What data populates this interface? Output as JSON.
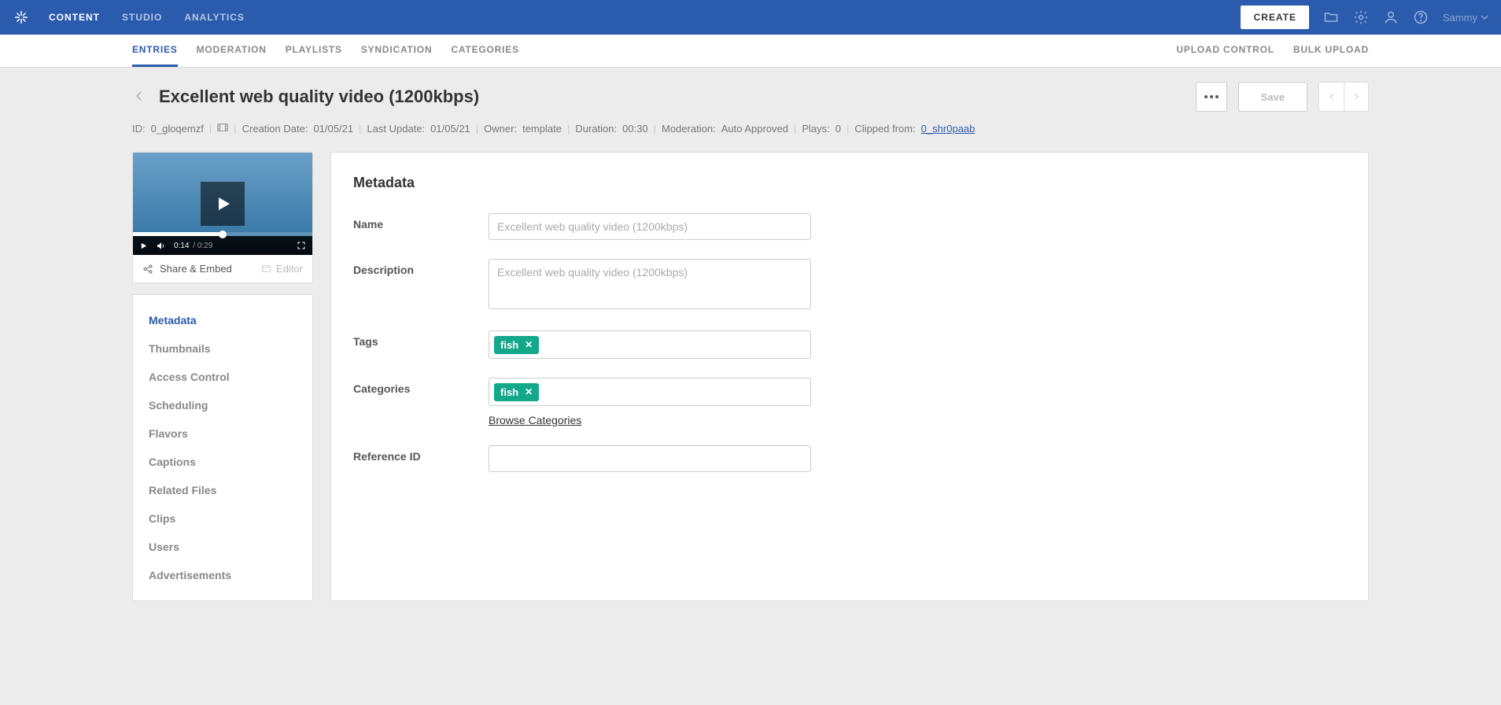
{
  "topnav": {
    "items": [
      "CONTENT",
      "STUDIO",
      "ANALYTICS"
    ],
    "active": 0
  },
  "topbar": {
    "create": "CREATE",
    "username": "Sammy"
  },
  "subnav": {
    "left": [
      "ENTRIES",
      "MODERATION",
      "PLAYLISTS",
      "SYNDICATION",
      "CATEGORIES"
    ],
    "active": 0,
    "right": [
      "UPLOAD CONTROL",
      "BULK UPLOAD"
    ]
  },
  "page": {
    "title": "Excellent web quality video (1200kbps)",
    "save": "Save"
  },
  "meta": {
    "id_label": "ID:",
    "id": "0_gloqemzf",
    "creation_label": "Creation Date:",
    "creation": "01/05/21",
    "update_label": "Last Update:",
    "update": "01/05/21",
    "owner_label": "Owner:",
    "owner": "template",
    "duration_label": "Duration:",
    "duration": "00:30",
    "moderation_label": "Moderation:",
    "moderation": "Auto Approved",
    "plays_label": "Plays:",
    "plays": "0",
    "clipped_label": "Clipped from:",
    "clipped": "0_shr0paab"
  },
  "player": {
    "time": "0:14",
    "duration": "0:29",
    "share": "Share & Embed",
    "editor": "Editor"
  },
  "sidenav": [
    "Metadata",
    "Thumbnails",
    "Access Control",
    "Scheduling",
    "Flavors",
    "Captions",
    "Related Files",
    "Clips",
    "Users",
    "Advertisements"
  ],
  "sidenav_active": 0,
  "panel": {
    "title": "Metadata",
    "labels": {
      "name": "Name",
      "description": "Description",
      "tags": "Tags",
      "categories": "Categories",
      "reference": "Reference ID",
      "browse": "Browse Categories"
    },
    "values": {
      "name_placeholder": "Excellent web quality video (1200kbps)",
      "description_placeholder": "Excellent web quality video (1200kbps)",
      "tag": "fish",
      "category": "fish"
    }
  }
}
